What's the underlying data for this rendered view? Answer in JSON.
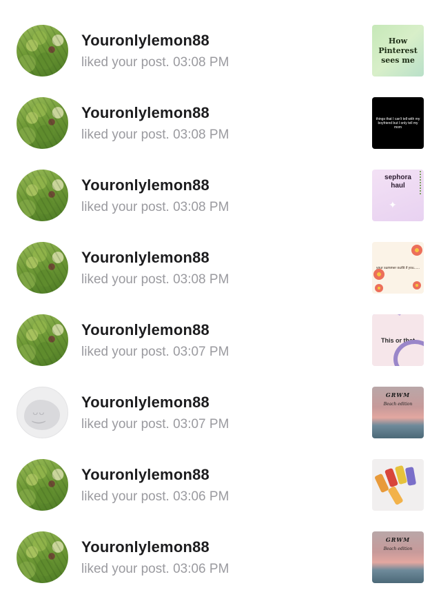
{
  "notifications": [
    {
      "username": "Youronlylemon88",
      "action": "liked your post. 03:08 PM",
      "avatar": "moss-photo",
      "thumb_text": [
        "How",
        "Pinterest",
        "sees me"
      ]
    },
    {
      "username": "Youronlylemon88",
      "action": "liked your post. 03:08 PM",
      "avatar": "moss-photo",
      "thumb_text": "things that I can't tell with my boyfriend but I only tell my mom"
    },
    {
      "username": "Youronlylemon88",
      "action": "liked your post. 03:08 PM",
      "avatar": "moss-photo",
      "thumb_text": [
        "sephora",
        "haul"
      ]
    },
    {
      "username": "Youronlylemon88",
      "action": "liked your post. 03:08 PM",
      "avatar": "moss-photo",
      "thumb_text": "your summer outfit if you......"
    },
    {
      "username": "Youronlylemon88",
      "action": "liked your post. 03:07 PM",
      "avatar": "moss-photo",
      "thumb_text": "This or that"
    },
    {
      "username": "Youronlylemon88",
      "action": "liked your post. 03:07 PM",
      "avatar": "default-avatar",
      "thumb_text": [
        "GRWM",
        "Beach edition"
      ]
    },
    {
      "username": "Youronlylemon88",
      "action": "liked your post. 03:06 PM",
      "avatar": "moss-photo",
      "thumb_text": ""
    },
    {
      "username": "Youronlylemon88",
      "action": "liked your post. 03:06 PM",
      "avatar": "moss-photo",
      "thumb_text": [
        "GRWM",
        "Beach edition"
      ]
    }
  ],
  "colors": {
    "username": "#1c1c1e",
    "secondary_text": "#9a9a9f",
    "background": "#ffffff"
  }
}
